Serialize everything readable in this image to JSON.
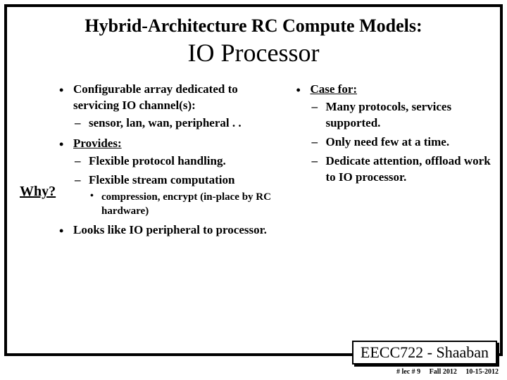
{
  "title": {
    "line1_prefix": "Hybrid-Architecture RC Compute Models:",
    "line2": "IO Processor"
  },
  "why_label": "Why?",
  "left": {
    "b1": "Configurable array dedicated to servicing IO channel(s):",
    "b1_s1": "sensor, lan, wan, peripheral . .",
    "b2": "Provides:",
    "b2_s1": "Flexible protocol handling.",
    "b2_s2": "Flexible stream computation",
    "b2_s2_s1": "compression, encrypt (in-place by RC hardware)",
    "b3": "Looks like IO peripheral to processor."
  },
  "right": {
    "b1": "Case for:",
    "b1_s1": "Many protocols, services supported.",
    "b1_s2": "Only need few at a time.",
    "b1_s3": "Dedicate attention, offload work to IO processor."
  },
  "footer": {
    "course": "EECC722 - Shaaban",
    "lec": "#  lec # 9",
    "term": "Fall 2012",
    "date": "10-15-2012"
  }
}
